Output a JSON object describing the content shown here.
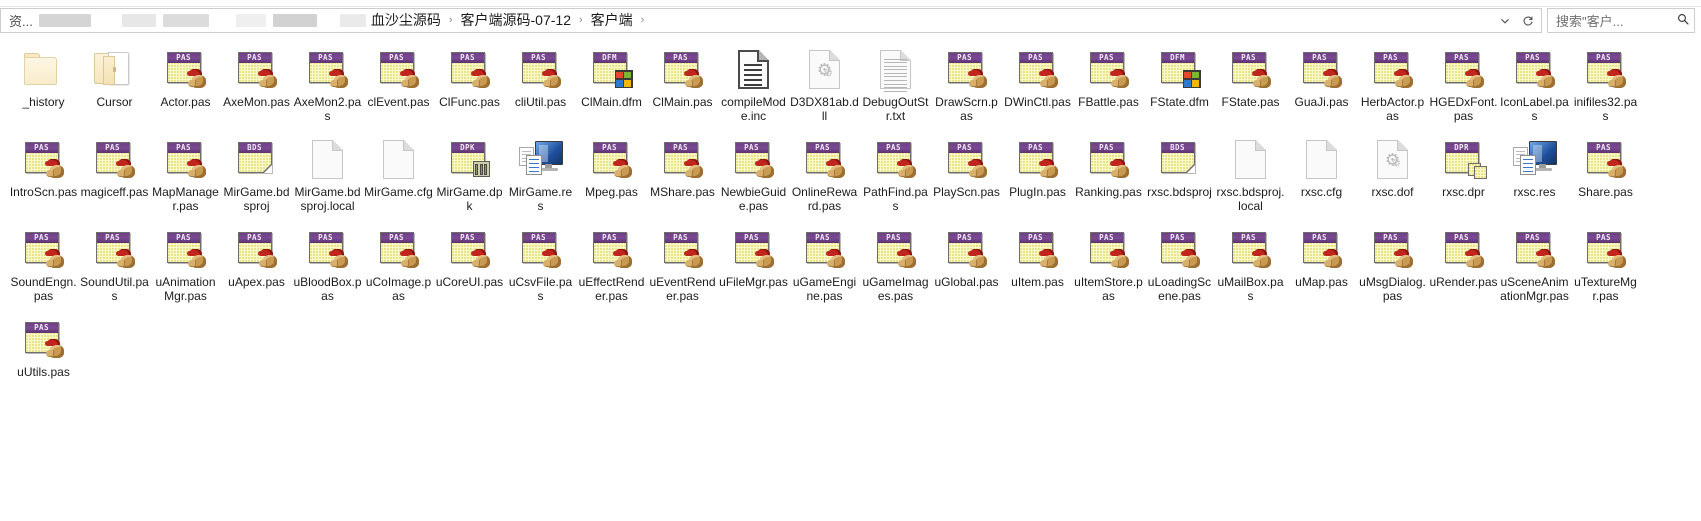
{
  "window": {
    "title": "客户端"
  },
  "address_bar": {
    "leading_text": "资...",
    "redacted_segments": 6,
    "breadcrumbs": [
      "血沙尘源码",
      "客户端源码-07-12",
      "客户端"
    ],
    "separator": "›",
    "dropdown_icon": "chevron-down-icon",
    "refresh_icon": "refresh-icon"
  },
  "search": {
    "placeholder": "搜索\"客户...",
    "icon": "search-icon"
  },
  "colors": {
    "delphi_band": "#6f3e87",
    "delphi_body": "#fbfbc9",
    "folder": "#f8eccb",
    "text": "#1c1c1c",
    "window_bg": "#ffffff"
  },
  "files": [
    {
      "name": "_history",
      "icon": "folder-closed-icon",
      "type": "folder"
    },
    {
      "name": "Cursor",
      "icon": "folder-open-icon",
      "type": "folder"
    },
    {
      "name": "Actor.pas",
      "icon": "delphi-pas-icon",
      "type": "pas",
      "badge": "PAS"
    },
    {
      "name": "AxeMon.pas",
      "icon": "delphi-pas-icon",
      "type": "pas",
      "badge": "PAS"
    },
    {
      "name": "AxeMon2.pas",
      "icon": "delphi-pas-icon",
      "type": "pas",
      "badge": "PAS"
    },
    {
      "name": "clEvent.pas",
      "icon": "delphi-pas-icon",
      "type": "pas",
      "badge": "PAS"
    },
    {
      "name": "ClFunc.pas",
      "icon": "delphi-pas-icon",
      "type": "pas",
      "badge": "PAS"
    },
    {
      "name": "cliUtil.pas",
      "icon": "delphi-pas-icon",
      "type": "pas",
      "badge": "PAS"
    },
    {
      "name": "ClMain.dfm",
      "icon": "delphi-dfm-icon",
      "type": "dfm",
      "badge": "DFM"
    },
    {
      "name": "ClMain.pas",
      "icon": "delphi-pas-icon",
      "type": "pas",
      "badge": "PAS"
    },
    {
      "name": "compileMode.inc",
      "icon": "document-bold-icon",
      "type": "inc"
    },
    {
      "name": "D3DX81ab.dll",
      "icon": "document-gear-icon",
      "type": "dll"
    },
    {
      "name": "DebugOutStr.txt",
      "icon": "document-text-icon",
      "type": "txt"
    },
    {
      "name": "DrawScrn.pas",
      "icon": "delphi-pas-icon",
      "type": "pas",
      "badge": "PAS"
    },
    {
      "name": "DWinCtl.pas",
      "icon": "delphi-pas-icon",
      "type": "pas",
      "badge": "PAS"
    },
    {
      "name": "FBattle.pas",
      "icon": "delphi-pas-icon",
      "type": "pas",
      "badge": "PAS"
    },
    {
      "name": "FState.dfm",
      "icon": "delphi-dfm-icon",
      "type": "dfm",
      "badge": "DFM"
    },
    {
      "name": "FState.pas",
      "icon": "delphi-pas-icon",
      "type": "pas",
      "badge": "PAS"
    },
    {
      "name": "GuaJi.pas",
      "icon": "delphi-pas-icon",
      "type": "pas",
      "badge": "PAS"
    },
    {
      "name": "HerbActor.pas",
      "icon": "delphi-pas-icon",
      "type": "pas",
      "badge": "PAS"
    },
    {
      "name": "HGEDxFont.pas",
      "icon": "delphi-pas-icon",
      "type": "pas",
      "badge": "PAS"
    },
    {
      "name": "IconLabel.pas",
      "icon": "delphi-pas-icon",
      "type": "pas",
      "badge": "PAS"
    },
    {
      "name": "inifiles32.pas",
      "icon": "delphi-pas-icon",
      "type": "pas",
      "badge": "PAS"
    },
    {
      "name": "IntroScn.pas",
      "icon": "delphi-pas-icon",
      "type": "pas",
      "badge": "PAS"
    },
    {
      "name": "magiceff.pas",
      "icon": "delphi-pas-icon",
      "type": "pas",
      "badge": "PAS"
    },
    {
      "name": "MapManager.pas",
      "icon": "delphi-pas-icon",
      "type": "pas",
      "badge": "PAS"
    },
    {
      "name": "MirGame.bdsproj",
      "icon": "delphi-bds-icon",
      "type": "bdsproj",
      "badge": "BDS"
    },
    {
      "name": "MirGame.bdsproj.local",
      "icon": "document-blank-icon",
      "type": "local"
    },
    {
      "name": "MirGame.cfg",
      "icon": "document-blank-icon",
      "type": "cfg"
    },
    {
      "name": "MirGame.dpk",
      "icon": "delphi-dpk-icon",
      "type": "dpk",
      "badge": "DPK"
    },
    {
      "name": "MirGame.res",
      "icon": "resource-monitor-icon",
      "type": "res"
    },
    {
      "name": "Mpeg.pas",
      "icon": "delphi-pas-icon",
      "type": "pas",
      "badge": "PAS"
    },
    {
      "name": "MShare.pas",
      "icon": "delphi-pas-icon",
      "type": "pas",
      "badge": "PAS"
    },
    {
      "name": "NewbieGuide.pas",
      "icon": "delphi-pas-icon",
      "type": "pas",
      "badge": "PAS"
    },
    {
      "name": "OnlineReward.pas",
      "icon": "delphi-pas-icon",
      "type": "pas",
      "badge": "PAS"
    },
    {
      "name": "PathFind.pas",
      "icon": "delphi-pas-icon",
      "type": "pas",
      "badge": "PAS"
    },
    {
      "name": "PlayScn.pas",
      "icon": "delphi-pas-icon",
      "type": "pas",
      "badge": "PAS"
    },
    {
      "name": "PlugIn.pas",
      "icon": "delphi-pas-icon",
      "type": "pas",
      "badge": "PAS"
    },
    {
      "name": "Ranking.pas",
      "icon": "delphi-pas-icon",
      "type": "pas",
      "badge": "PAS"
    },
    {
      "name": "rxsc.bdsproj",
      "icon": "delphi-bds-icon",
      "type": "bdsproj",
      "badge": "BDS"
    },
    {
      "name": "rxsc.bdsproj.local",
      "icon": "document-blank-icon",
      "type": "local"
    },
    {
      "name": "rxsc.cfg",
      "icon": "document-blank-icon",
      "type": "cfg"
    },
    {
      "name": "rxsc.dof",
      "icon": "document-gear-icon",
      "type": "dof"
    },
    {
      "name": "rxsc.dpr",
      "icon": "delphi-dpr-icon",
      "type": "dpr",
      "badge": "DPR"
    },
    {
      "name": "rxsc.res",
      "icon": "resource-monitor-icon",
      "type": "res"
    },
    {
      "name": "Share.pas",
      "icon": "delphi-pas-icon",
      "type": "pas",
      "badge": "PAS"
    },
    {
      "name": "SoundEngn.pas",
      "icon": "delphi-pas-icon",
      "type": "pas",
      "badge": "PAS"
    },
    {
      "name": "SoundUtil.pas",
      "icon": "delphi-pas-icon",
      "type": "pas",
      "badge": "PAS"
    },
    {
      "name": "uAnimationMgr.pas",
      "icon": "delphi-pas-icon",
      "type": "pas",
      "badge": "PAS"
    },
    {
      "name": "uApex.pas",
      "icon": "delphi-pas-icon",
      "type": "pas",
      "badge": "PAS"
    },
    {
      "name": "uBloodBox.pas",
      "icon": "delphi-pas-icon",
      "type": "pas",
      "badge": "PAS"
    },
    {
      "name": "uCoImage.pas",
      "icon": "delphi-pas-icon",
      "type": "pas",
      "badge": "PAS"
    },
    {
      "name": "uCoreUI.pas",
      "icon": "delphi-pas-icon",
      "type": "pas",
      "badge": "PAS"
    },
    {
      "name": "uCsvFile.pas",
      "icon": "delphi-pas-icon",
      "type": "pas",
      "badge": "PAS"
    },
    {
      "name": "uEffectRender.pas",
      "icon": "delphi-pas-icon",
      "type": "pas",
      "badge": "PAS"
    },
    {
      "name": "uEventRender.pas",
      "icon": "delphi-pas-icon",
      "type": "pas",
      "badge": "PAS"
    },
    {
      "name": "uFileMgr.pas",
      "icon": "delphi-pas-icon",
      "type": "pas",
      "badge": "PAS"
    },
    {
      "name": "uGameEngine.pas",
      "icon": "delphi-pas-icon",
      "type": "pas",
      "badge": "PAS"
    },
    {
      "name": "uGameImages.pas",
      "icon": "delphi-pas-icon",
      "type": "pas",
      "badge": "PAS"
    },
    {
      "name": "uGlobal.pas",
      "icon": "delphi-pas-icon",
      "type": "pas",
      "badge": "PAS"
    },
    {
      "name": "uItem.pas",
      "icon": "delphi-pas-icon",
      "type": "pas",
      "badge": "PAS"
    },
    {
      "name": "uItemStore.pas",
      "icon": "delphi-pas-icon",
      "type": "pas",
      "badge": "PAS"
    },
    {
      "name": "uLoadingScene.pas",
      "icon": "delphi-pas-icon",
      "type": "pas",
      "badge": "PAS"
    },
    {
      "name": "uMailBox.pas",
      "icon": "delphi-pas-icon",
      "type": "pas",
      "badge": "PAS"
    },
    {
      "name": "uMap.pas",
      "icon": "delphi-pas-icon",
      "type": "pas",
      "badge": "PAS"
    },
    {
      "name": "uMsgDialog.pas",
      "icon": "delphi-pas-icon",
      "type": "pas",
      "badge": "PAS"
    },
    {
      "name": "uRender.pas",
      "icon": "delphi-pas-icon",
      "type": "pas",
      "badge": "PAS"
    },
    {
      "name": "uSceneAnimationMgr.pas",
      "icon": "delphi-pas-icon",
      "type": "pas",
      "badge": "PAS"
    },
    {
      "name": "uTextureMgr.pas",
      "icon": "delphi-pas-icon",
      "type": "pas",
      "badge": "PAS"
    },
    {
      "name": "uUtils.pas",
      "icon": "delphi-pas-icon",
      "type": "pas",
      "badge": "PAS"
    }
  ]
}
